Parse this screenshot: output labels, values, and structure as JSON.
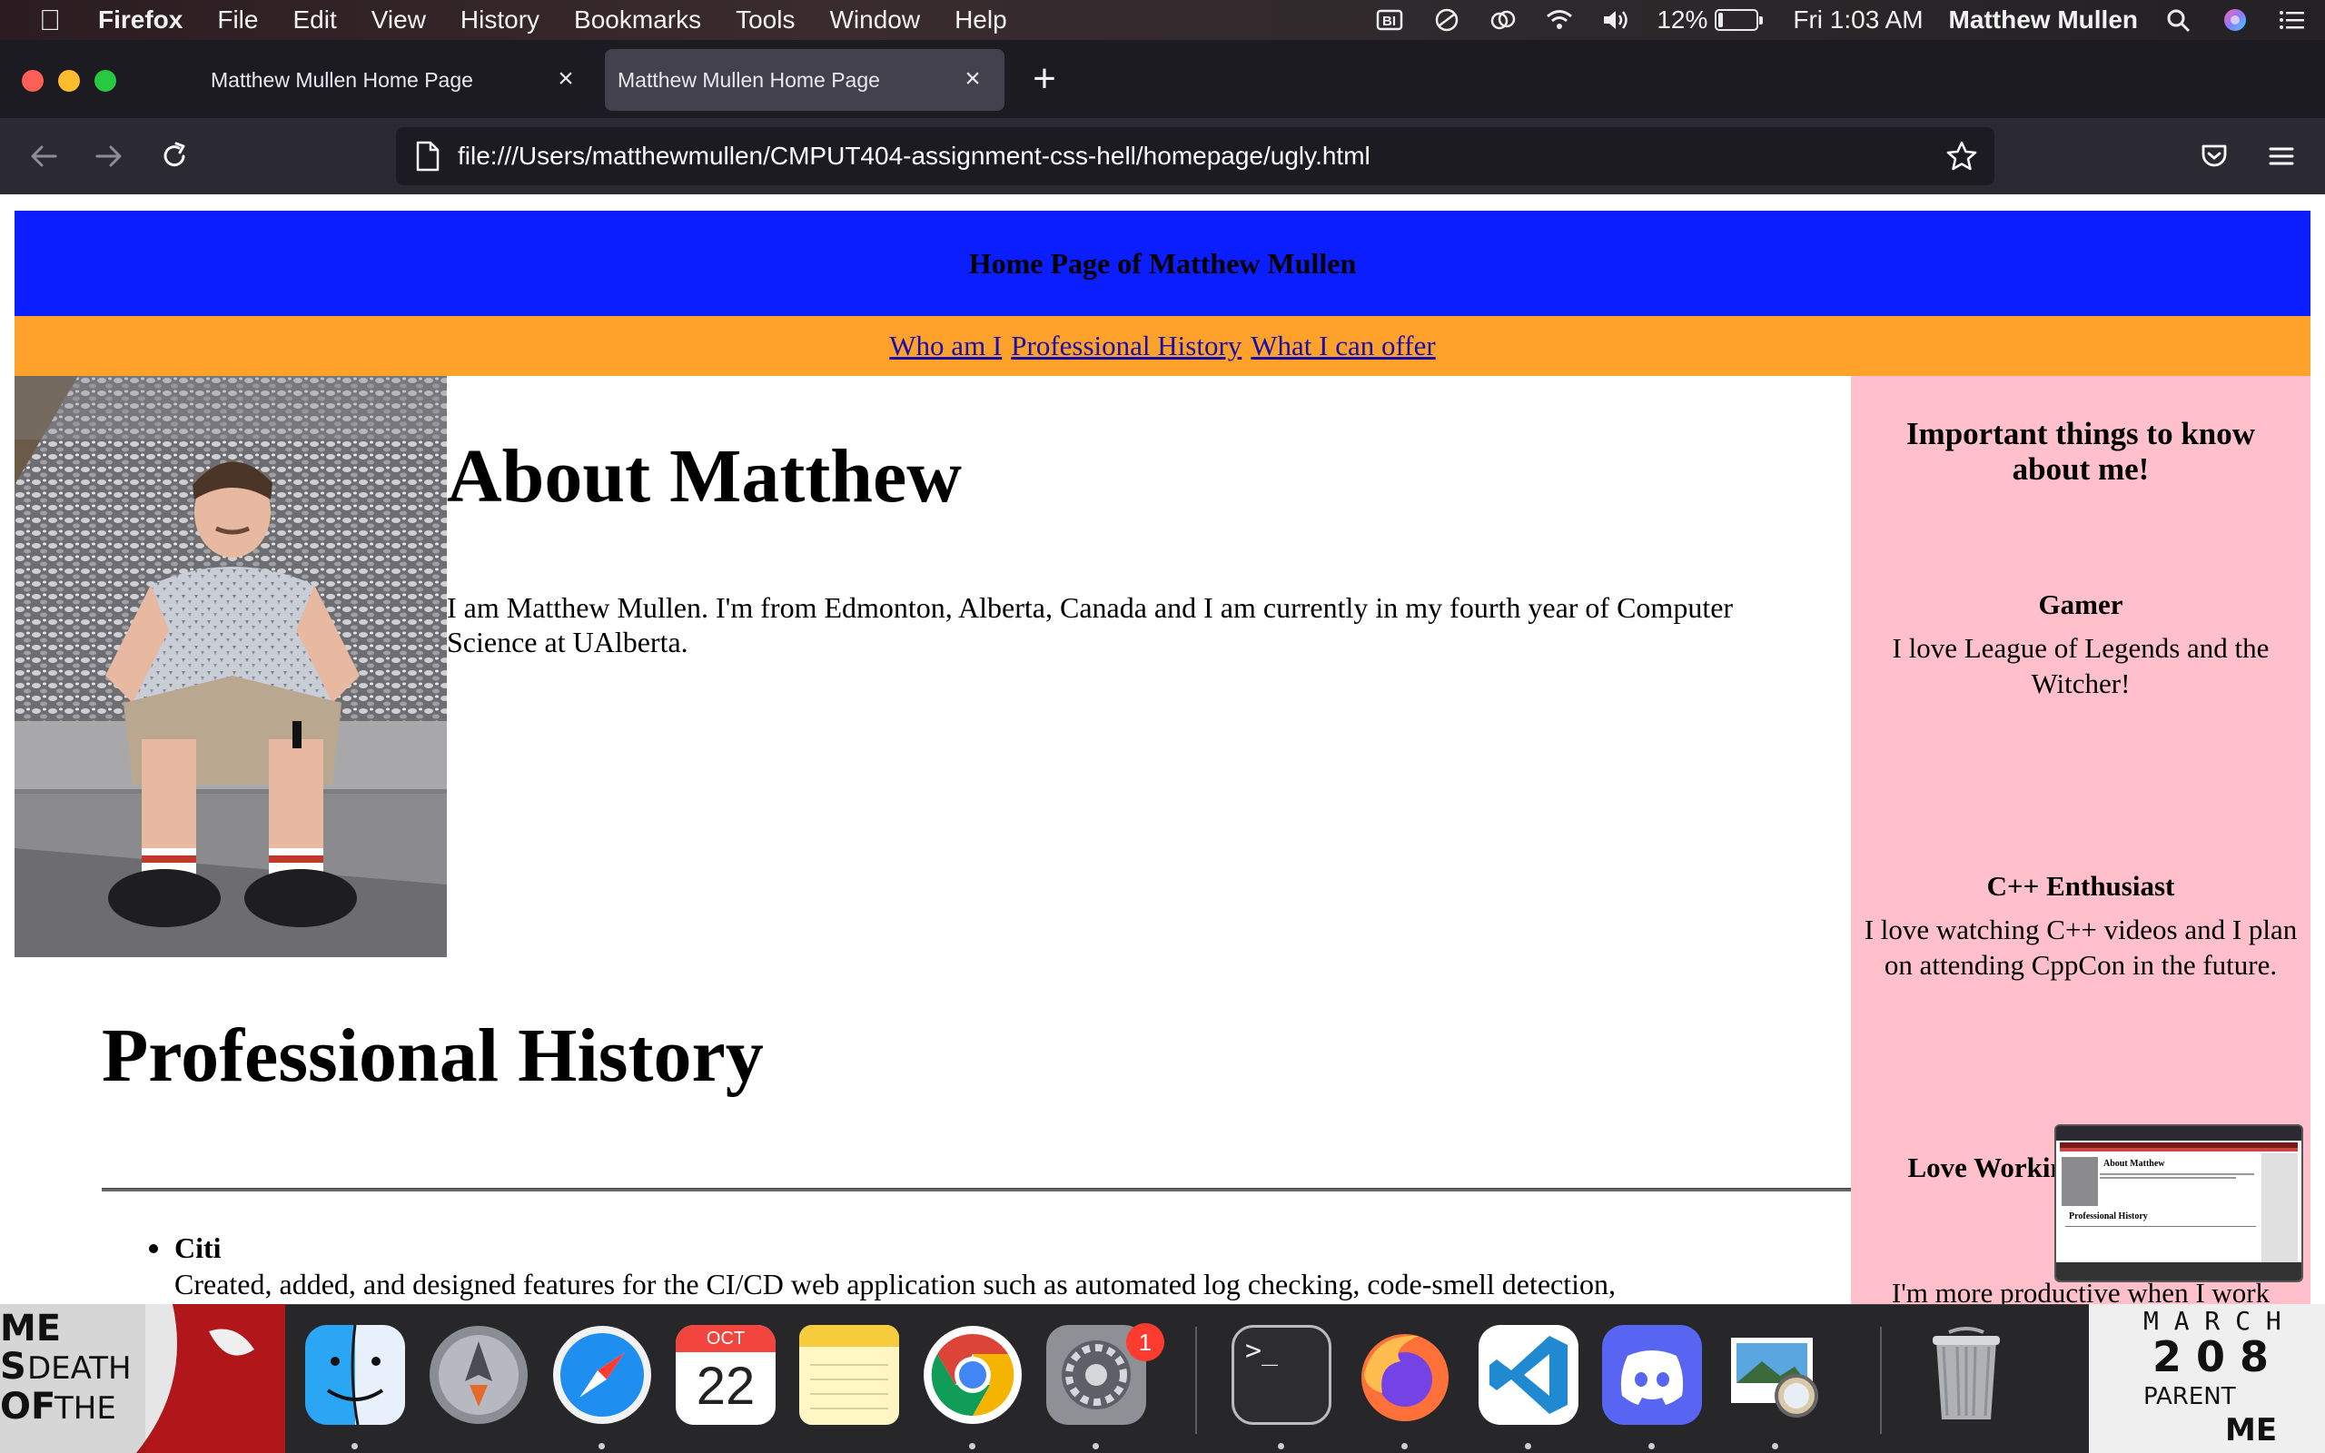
{
  "menubar": {
    "app_name": "Firefox",
    "menus": [
      "File",
      "Edit",
      "View",
      "History",
      "Bookmarks",
      "Tools",
      "Window",
      "Help"
    ],
    "battery_percent": "12%",
    "battery_level": 0.12,
    "clock": "Fri 1:03 AM",
    "user": "Matthew Mullen"
  },
  "browser": {
    "tabs": [
      {
        "title": "Matthew Mullen Home Page"
      },
      {
        "title": "Matthew Mullen Home Page"
      }
    ],
    "url": "file:///Users/matthewmullen/CMPUT404-assignment-css-hell/homepage/ugly.html"
  },
  "page": {
    "header_title": "Home Page of Matthew Mullen",
    "nav_links": [
      "Who am I",
      "Professional History",
      "What I can offer"
    ],
    "about_title": "About Matthew",
    "about_text": "I am Matthew Mullen. I'm from Edmonton, Alberta, Canada and I am currently in my fourth year of Computer Science at UAlberta.",
    "history_title": "Professional History",
    "history_items": [
      {
        "company": "Citi",
        "description": "Created, added, and designed features for the CI/CD web application such as automated log checking, code-smell detection,"
      }
    ],
    "sidebar": {
      "title": "Important things to know about me!",
      "items": [
        {
          "title": "Gamer",
          "text": "I love League of Legends and the Witcher!"
        },
        {
          "title": "C++ Enthusiast",
          "text": "I love watching C++ videos and I plan on attending CppCon in the future."
        },
        {
          "title": "Love Working and designing",
          "text": "I'm more productive when I work"
        }
      ]
    },
    "thumbnail": {
      "about_label": "About Matthew",
      "history_label": "Professional History"
    }
  },
  "dock": {
    "calendar_month": "OCT",
    "calendar_day": "22",
    "settings_badge": "1",
    "terminal_prompt": ">_"
  },
  "colors": {
    "header_bg": "#0a1eff",
    "nav_bg": "#ffa22c",
    "sidebar_bg": "#ffc0cb",
    "link": "#1a0dab"
  }
}
